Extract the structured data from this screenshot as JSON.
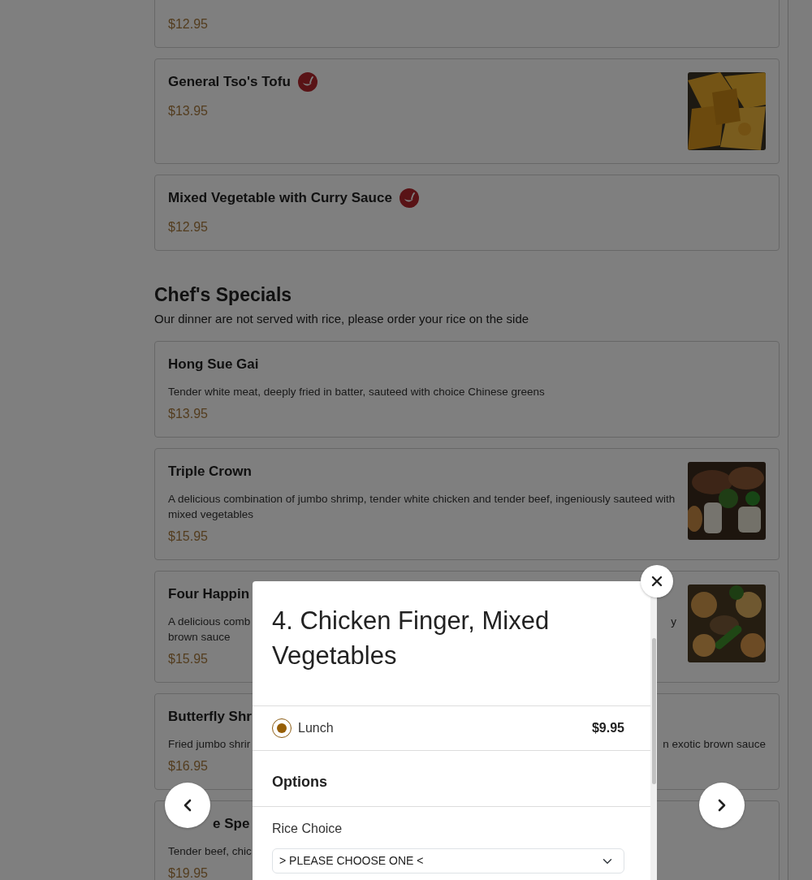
{
  "sections": [
    {
      "items": [
        {
          "price": "$12.95",
          "spicy": false,
          "picture": false
        },
        {
          "name": "General Tso's Tofu",
          "price": "$13.95",
          "spicy": true,
          "picture": true
        },
        {
          "name": "Mixed Vegetable with Curry Sauce",
          "price": "$12.95",
          "spicy": true,
          "picture": false
        }
      ]
    },
    {
      "title": "Chef's Specials",
      "note": "Our dinner are not served with rice, please order your rice on the side",
      "items": [
        {
          "name": "Hong Sue Gai",
          "description": "Tender white meat, deeply fried in batter, sauteed with choice Chinese greens",
          "price": "$13.95",
          "spicy": false,
          "picture": false
        },
        {
          "name": "Triple Crown",
          "description": "A delicious combination of jumbo shrimp, tender white chicken and tender beef, ingeniously sauteed with mixed vegetables",
          "price": "$15.95",
          "spicy": false,
          "picture": true
        },
        {
          "name": "Four Happin",
          "description_lines": [
            [
              "A delicious comb",
              "y"
            ],
            [
              "brown sauce"
            ]
          ],
          "price": "$15.95",
          "spicy": false,
          "picture": true
        },
        {
          "name": "Butterfly Shr",
          "description_lines": [
            [
              "Fried jumbo shrir",
              "n exotic brown sauce"
            ]
          ],
          "price": "$16.95",
          "spicy": false,
          "picture": false
        },
        {
          "name": "e Spe",
          "covered_start": true,
          "description": "Tender beef, chic",
          "price": "$19.95",
          "spicy": false,
          "picture": false
        }
      ]
    }
  ],
  "modal": {
    "title": "4. Chicken Finger, Mixed Vegetables",
    "sizes": [
      {
        "label": "Lunch",
        "price": "$9.95",
        "selected": true
      }
    ],
    "options_heading": "Options",
    "fields": [
      {
        "label": "Rice Choice",
        "value": "> PLEASE CHOOSE ONE <"
      }
    ]
  }
}
